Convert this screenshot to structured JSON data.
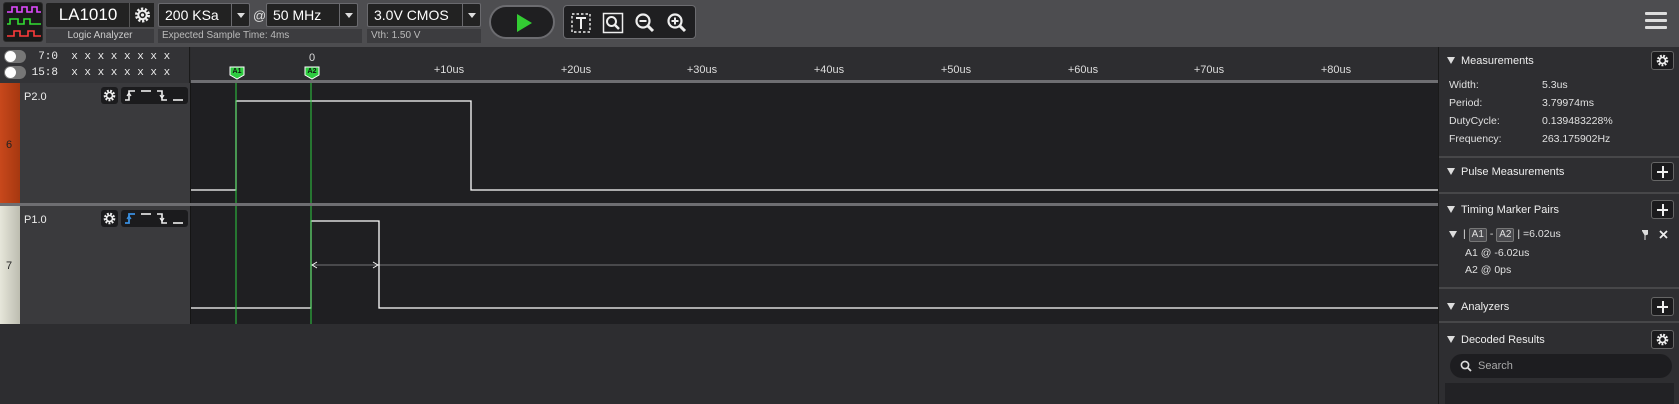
{
  "device": {
    "name": "LA1010",
    "type": "Logic Analyzer"
  },
  "sample_rate": {
    "value": "200 KSa"
  },
  "at_symbol": "@",
  "sample_freq": {
    "value": "50 MHz"
  },
  "voltage": {
    "value": "3.0V CMOS"
  },
  "expected_sample_time": "Expected Sample Time: 4ms",
  "vth": "Vth:  1.50 V",
  "groups": [
    {
      "label": "7:0",
      "bits": "x x x x x x x x"
    },
    {
      "label": "15:8",
      "bits": "x x x x x x x x"
    }
  ],
  "ruler": {
    "zero_label": "0",
    "ticks": [
      "+10us",
      "+20us",
      "+30us",
      "+40us",
      "+50us",
      "+60us",
      "+70us",
      "+80us"
    ],
    "markers": [
      "A1",
      "A2"
    ]
  },
  "channels": [
    {
      "name": "P2.0",
      "number": "6",
      "color": "#c8481c"
    },
    {
      "name": "P1.0",
      "number": "7",
      "color": "#dcdcd0"
    }
  ],
  "panel": {
    "measurements": {
      "title": "Measurements",
      "rows": [
        {
          "label": "Width:",
          "value": "5.3us"
        },
        {
          "label": "Period:",
          "value": "3.79974ms"
        },
        {
          "label": "DutyCycle:",
          "value": "0.139483228%"
        },
        {
          "label": "Frequency:",
          "value": "263.175902Hz"
        }
      ]
    },
    "pulse_measurements": {
      "title": "Pulse Measurements"
    },
    "timing_marker_pairs": {
      "title": "Timing Marker Pairs",
      "pair": {
        "a": "A1",
        "sep": "-",
        "b": "A2",
        "result": "=6.02us",
        "a_at": "A1 @ -6.02us",
        "b_at": "A2 @ 0ps"
      }
    },
    "analyzers": {
      "title": "Analyzers"
    },
    "decoded_results": {
      "title": "Decoded Results",
      "search_placeholder": "Search"
    }
  },
  "colors": {
    "accent_green": "#33cc33",
    "marker_green": "#2ecc40",
    "trigger_blue": "#3a8fe0",
    "trace_white": "#ffffff"
  }
}
